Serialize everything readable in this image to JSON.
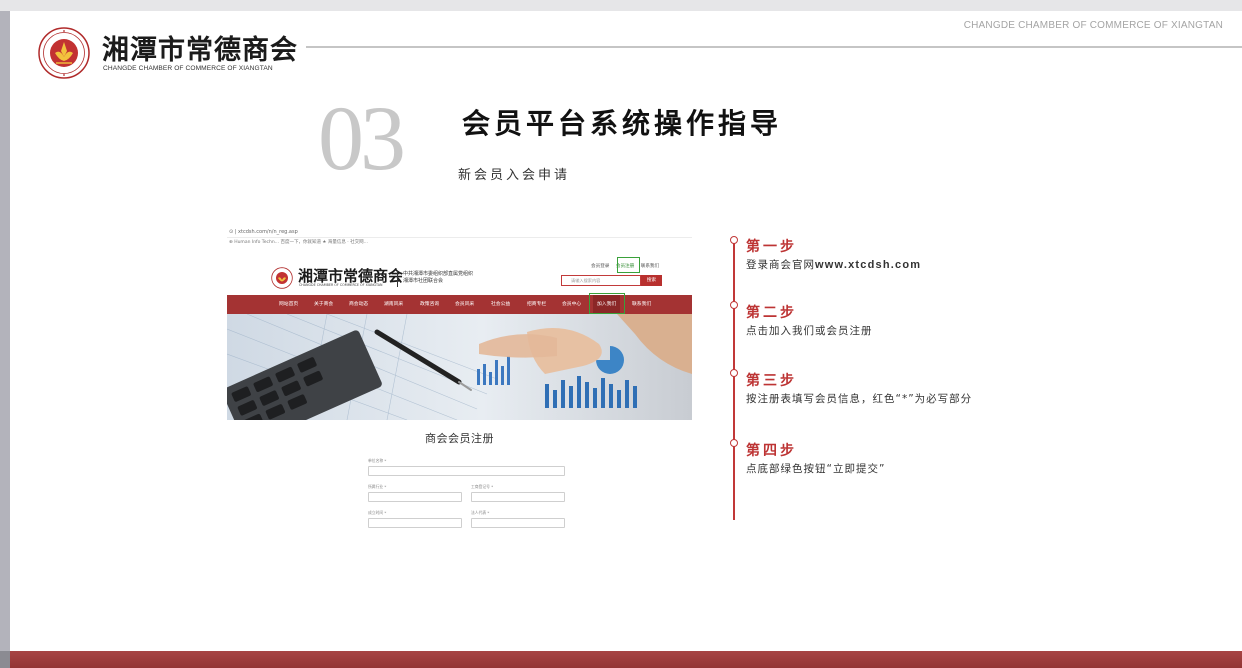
{
  "header": {
    "logo_cn": "湘潭市常德商会",
    "logo_en": "CHANGDE CHAMBER OF COMMERCE OF XIANGTAN",
    "right_en": "CHANGDE CHAMBER OF COMMERCE OF XIANGTAN"
  },
  "section": {
    "number": "03",
    "title": "会员平台系统操作指导",
    "subtitle": "新会员入会申请"
  },
  "screenshot": {
    "url": "⊙ | xtcdsh.com/n/n_reg.asp",
    "bookmarks": "⊕ Human Info Techn...   百度一下，你就知道   ★ 海量信息 · 社交网...",
    "top_links": [
      "会员登录",
      "会员注册",
      "联系我们"
    ],
    "logo_cn": "湘潭市常德商会",
    "logo_en": "CHANGDE CHAMBER OF COMMERCE OF XIANGTAN",
    "org_line1": "中共湘潭市委组织部直属党组织",
    "org_line2": "湘潭市社团联合会",
    "search_placeholder": "请输入搜索内容",
    "search_button": "搜索",
    "nav": [
      "网站首页",
      "关于商会",
      "商会动态",
      "湖南风采",
      "政策咨询",
      "会员风采",
      "社会公益",
      "招商专栏",
      "会员中心",
      "加入我们",
      "联系我们"
    ],
    "form_title": "商会会员注册",
    "form_labels": [
      "单位名称 *",
      "所属行业 *",
      "工商登记号 *",
      "成立时间 *",
      "法人代表 *"
    ]
  },
  "steps": [
    {
      "title": "第一步",
      "desc_prefix": "登录商会官网",
      "desc_strong": "www.xtcdsh.com"
    },
    {
      "title": "第二步",
      "desc": "点击加入我们或会员注册"
    },
    {
      "title": "第三步",
      "desc": "按注册表填写会员信息，红色“*”为必写部分"
    },
    {
      "title": "第四步",
      "desc": "点底部绿色按钮“立即提交”"
    }
  ],
  "colors": {
    "accent_red": "#bd3434",
    "highlight_green": "#3aa13a",
    "nav_red": "#a43333"
  }
}
